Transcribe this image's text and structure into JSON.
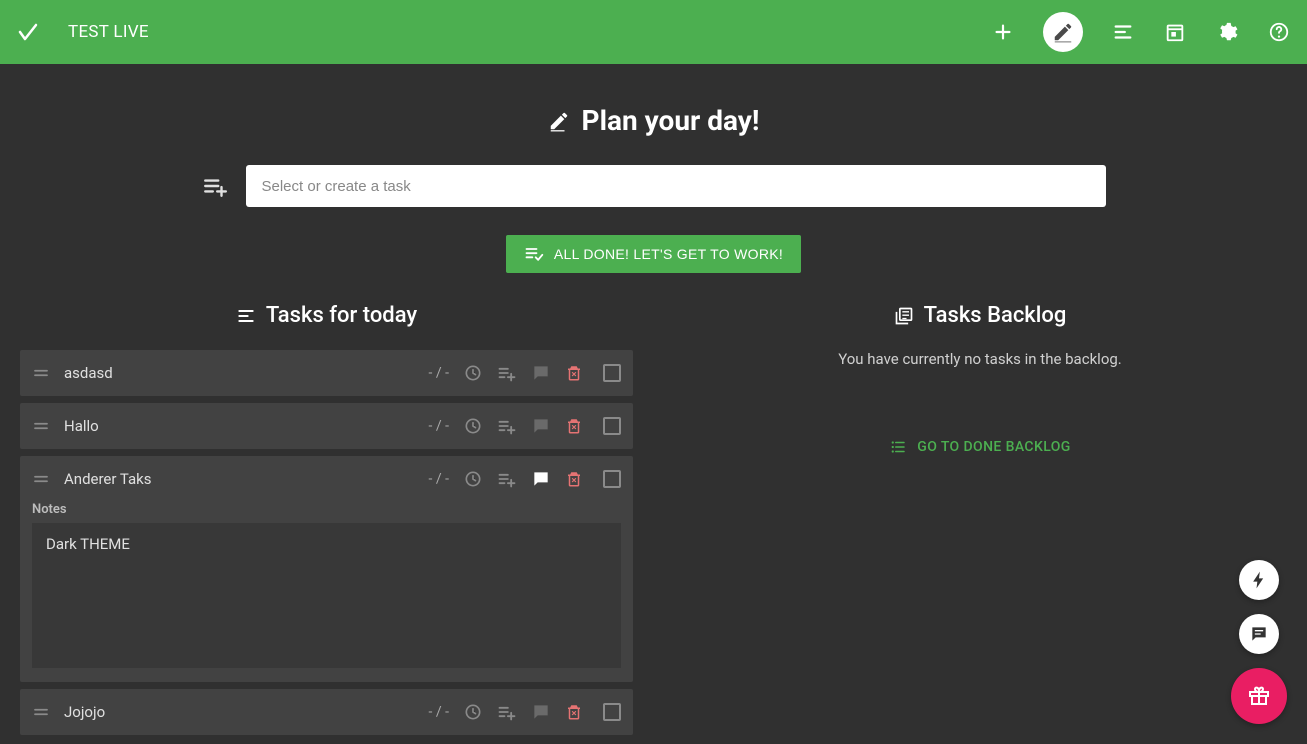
{
  "app": {
    "title": "TEST LIVE"
  },
  "colors": {
    "accent": "#4caf50",
    "fab_primary": "#e91e63",
    "delete": "#e57373"
  },
  "page": {
    "heading": "Plan your day!"
  },
  "add_task": {
    "placeholder": "Select or create a task"
  },
  "done_button": {
    "label": "ALL DONE! LET'S GET TO WORK!"
  },
  "left": {
    "heading": "Tasks for today",
    "time_placeholder": "- / -",
    "notes_label": "Notes",
    "tasks": [
      {
        "title": "asdasd",
        "time": "- / -",
        "notes_open": false,
        "notes": ""
      },
      {
        "title": "Hallo",
        "time": "- / -",
        "notes_open": false,
        "notes": ""
      },
      {
        "title": "Anderer Taks",
        "time": "- / -",
        "notes_open": true,
        "notes": "Dark THEME"
      },
      {
        "title": "Jojojo",
        "time": "- / -",
        "notes_open": false,
        "notes": ""
      }
    ]
  },
  "right": {
    "heading": "Tasks Backlog",
    "empty_text": "You have currently no tasks in the backlog.",
    "go_link": "GO TO DONE BACKLOG"
  }
}
